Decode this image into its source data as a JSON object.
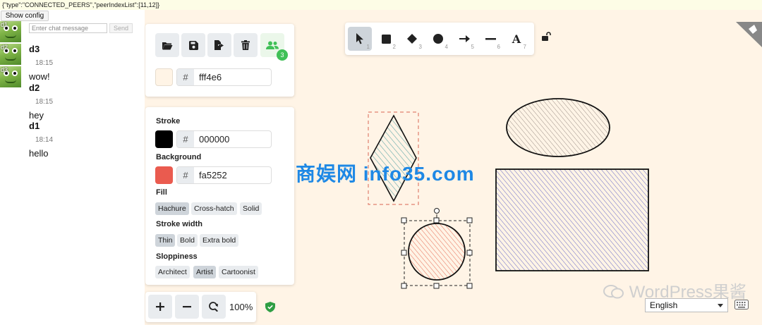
{
  "debug": {
    "text": "{\"type\":\"CONNECTED_PEERS\",\"peerIndexList\":[11,12]}"
  },
  "config_button": {
    "label": "Show config"
  },
  "chat": {
    "peers": [
      {
        "label": "d1"
      },
      {
        "label": "d2"
      },
      {
        "label": "d3"
      }
    ],
    "input_placeholder": "Enter chat message",
    "send_label": "Send",
    "messages": [
      {
        "user": "d3",
        "time": "18:15",
        "text": "wow!"
      },
      {
        "user": "d2",
        "time": "18:15",
        "text": "hey"
      },
      {
        "user": "d1",
        "time": "18:14",
        "text": "hello"
      }
    ]
  },
  "toolbar": {
    "collab_count": "3",
    "canvas_bg_hex": "fff4e6",
    "hash": "#"
  },
  "props": {
    "stroke_label": "Stroke",
    "stroke_hex": "000000",
    "background_label": "Background",
    "background_hex": "fa5252",
    "fill_label": "Fill",
    "fill_options": [
      "Hachure",
      "Cross-hatch",
      "Solid"
    ],
    "stroke_width_label": "Stroke width",
    "stroke_width_options": [
      "Thin",
      "Bold",
      "Extra bold"
    ],
    "sloppiness_label": "Sloppiness",
    "sloppiness_options": [
      "Architect",
      "Artist",
      "Cartoonist"
    ]
  },
  "shape_tools": [
    {
      "name": "selection",
      "key": "1"
    },
    {
      "name": "rectangle",
      "key": "2"
    },
    {
      "name": "diamond",
      "key": "3"
    },
    {
      "name": "ellipse",
      "key": "4"
    },
    {
      "name": "arrow",
      "key": "5"
    },
    {
      "name": "line",
      "key": "6"
    },
    {
      "name": "text",
      "key": "7",
      "glyph": "A"
    }
  ],
  "zoom": {
    "level": "100%"
  },
  "language": {
    "selected": "English"
  },
  "watermarks": {
    "center": "商娱网 info35.com",
    "brand": "WordPress果酱"
  },
  "colors": {
    "canvas": "#fff4e6",
    "stroke": "#000000",
    "background": "#fa5252",
    "accent_green": "#40c057"
  }
}
